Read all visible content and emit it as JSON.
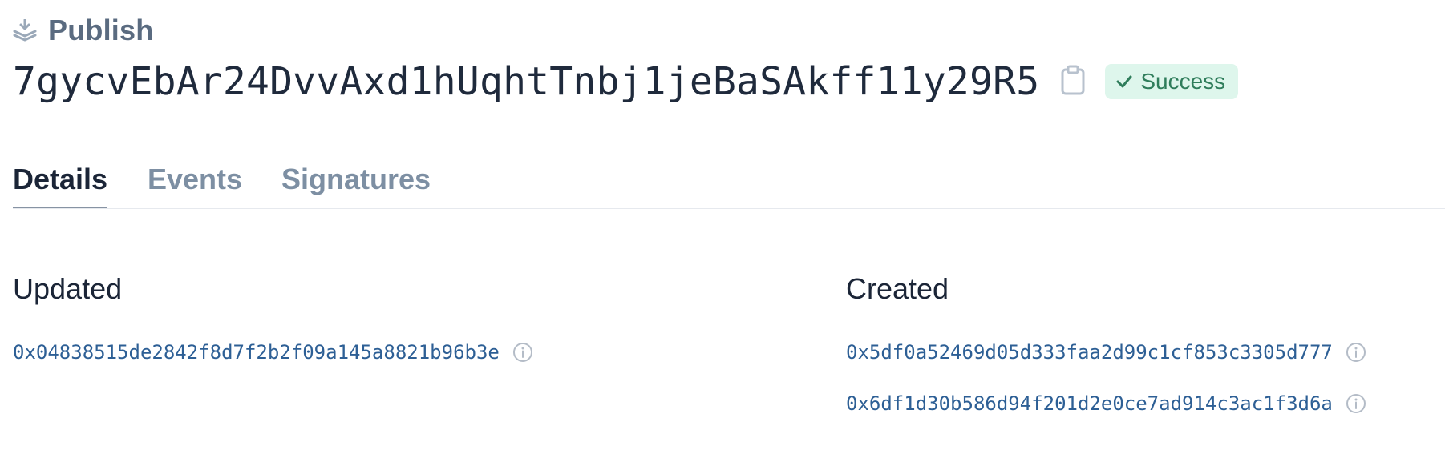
{
  "header": {
    "type_label": "Publish",
    "type_icon": "publish-stack-icon",
    "transaction_id": "7gycvEbAr24DvvAxd1hUqhtTnbj1jeBaSAkff11y29R5",
    "copy_icon": "clipboard-icon",
    "status": {
      "label": "Success",
      "icon": "check-icon",
      "bg_color": "#def6ec",
      "text_color": "#2f7d5b"
    }
  },
  "tabs": [
    {
      "label": "Details",
      "active": true
    },
    {
      "label": "Events",
      "active": false
    },
    {
      "label": "Signatures",
      "active": false
    }
  ],
  "sections": {
    "updated": {
      "title": "Updated",
      "objects": [
        "0x04838515de2842f8d7f2b2f09a145a8821b96b3e"
      ]
    },
    "created": {
      "title": "Created",
      "objects": [
        "0x5df0a52469d05d333faa2d99c1cf853c3305d777",
        "0x6df1d30b586d94f201d2e0ce7ad914c3ac1f3d6a"
      ]
    }
  },
  "colors": {
    "link": "#2d5f95",
    "muted": "#7d8fa3",
    "heading": "#1b2537"
  }
}
